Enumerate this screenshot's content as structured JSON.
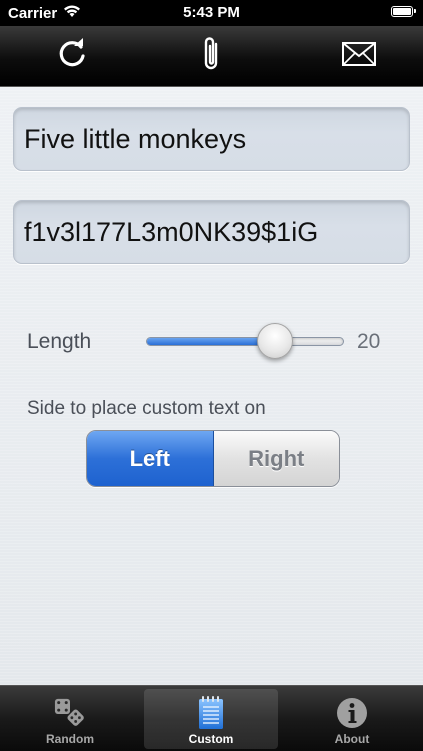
{
  "status_bar": {
    "carrier": "Carrier",
    "time": "5:43 PM",
    "wifi_icon": "wifi-icon",
    "battery_icon": "battery-icon"
  },
  "toolbar": {
    "refresh_icon": "refresh-icon",
    "attach_icon": "paperclip-icon",
    "mail_icon": "mail-icon"
  },
  "main": {
    "custom_text": "Five little monkeys",
    "generated_password": "f1v3l177L3m0NK39$1iG",
    "length_label": "Length",
    "length_value": "20",
    "length_slider_fraction": 0.65,
    "side_label": "Side to place custom text on",
    "side_options": [
      "Left",
      "Right"
    ],
    "side_selected": "Left"
  },
  "tabbar": {
    "tabs": [
      {
        "label": "Random",
        "icon": "dice-icon",
        "active": false
      },
      {
        "label": "Custom",
        "icon": "notepad-icon",
        "active": true
      },
      {
        "label": "About",
        "icon": "info-icon",
        "active": false
      }
    ]
  },
  "colors": {
    "accent_blue": "#2d70d8",
    "bar_black": "#000000",
    "field_bg": "#d8dfe8"
  }
}
